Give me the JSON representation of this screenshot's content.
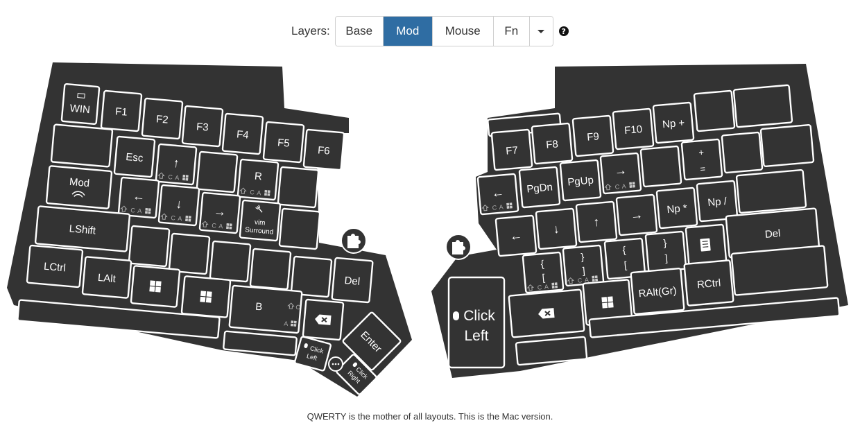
{
  "layer_selector": {
    "label": "Layers:",
    "options": [
      "Base",
      "Mod",
      "Mouse",
      "Fn"
    ],
    "active": "Mod",
    "active_color": "#2f6da3",
    "dropdown_icon": "caret-down-icon",
    "help_icon": "?"
  },
  "keyboard": {
    "case_color": "#333333",
    "key_border_color": "#ffffff",
    "left_keys": {
      "win": "WIN",
      "f1": "F1",
      "f2": "F2",
      "f3": "F3",
      "f4": "F4",
      "f5": "F5",
      "f6": "F6",
      "esc": "Esc",
      "up": "↑",
      "r": "R",
      "mod": "Mod",
      "left": "←",
      "down": "↓",
      "right": "→",
      "vim_line1": "vim",
      "vim_line2": "Surround",
      "lshift": "LShift",
      "lctrl": "LCtrl",
      "lalt": "LAlt",
      "b": "B",
      "del": "Del",
      "enter": "Enter",
      "click_left_line1": "Click",
      "click_left_line2": "Left",
      "click_right_line1": "Click",
      "click_right_line2": "Right"
    },
    "right_keys": {
      "f7": "F7",
      "f8": "F8",
      "f9": "F9",
      "f10": "F10",
      "np_plus": "Np +",
      "plus": "+",
      "equals": "=",
      "back": "←",
      "pgdn": "PgDn",
      "pgup": "PgUp",
      "arrow_right": "→",
      "left": "←",
      "down": "↓",
      "up": "↑",
      "right": "→",
      "np_star": "Np *",
      "np_slash": "Np /",
      "brace_open": "{",
      "brace_close": "}",
      "bracket_open": "[",
      "bracket_close": "]",
      "del": "Del",
      "ralt": "RAlt(Gr)",
      "rctrl": "RCtrl",
      "thumb_click_line1": "Click",
      "thumb_click_line2": "Left"
    },
    "modifier_glyphs": {
      "c": "C",
      "a": "A"
    }
  },
  "footer": {
    "text": "QWERTY is the mother of all layouts. This is the Mac version."
  }
}
